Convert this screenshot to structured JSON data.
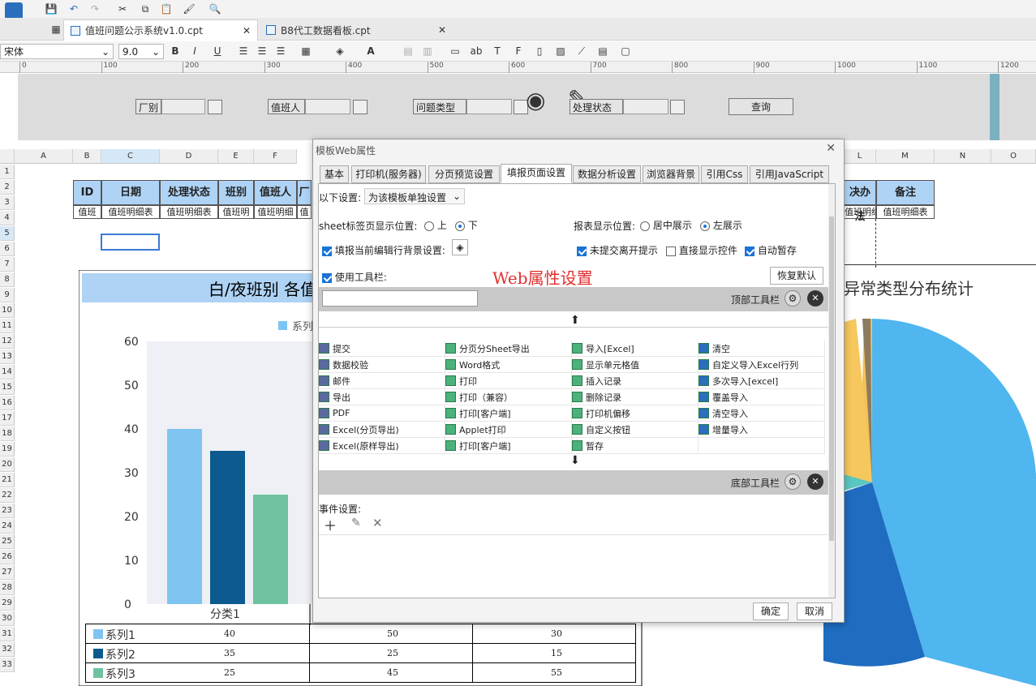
{
  "tabs": [
    {
      "label": "值班问题公示系统v1.0.cpt",
      "active": true
    },
    {
      "label": "B8代工数据看板.cpt",
      "active": false
    }
  ],
  "format": {
    "font": "宋体",
    "size": "9.0"
  },
  "ruler": [
    "0",
    "100",
    "200",
    "300",
    "400",
    "500",
    "600",
    "700",
    "800",
    "900",
    "1000",
    "1100",
    "1200"
  ],
  "params": {
    "factory": "厂别",
    "person": "值班人",
    "issue_type": "问题类型",
    "status": "处理状态",
    "query": "查询"
  },
  "columns": [
    "A",
    "B",
    "C",
    "D",
    "E",
    "F",
    "L",
    "M",
    "N",
    "O"
  ],
  "rows": [
    "1",
    "2",
    "3",
    "4",
    "5",
    "6",
    "7",
    "8",
    "9",
    "10",
    "11",
    "12",
    "13",
    "14",
    "15",
    "16",
    "17",
    "18",
    "19",
    "20",
    "21",
    "22",
    "23",
    "24",
    "25",
    "26",
    "27",
    "28",
    "29",
    "30",
    "31",
    "32",
    "33"
  ],
  "headers": [
    "ID",
    "日期",
    "处理状态",
    "班别",
    "值班人",
    "厂",
    "决办法",
    "备注"
  ],
  "datarow": [
    "值班",
    "值班明细表",
    "值班明细表",
    "值班明",
    "值班明细",
    "值",
    "值班明细表",
    "值班明细表"
  ],
  "chart_data": [
    {
      "type": "bar",
      "title": "白/夜班别 各值",
      "legend": "系列",
      "categories": [
        "分类1"
      ],
      "series": [
        {
          "name": "系列1",
          "values": [
            40
          ]
        },
        {
          "name": "系列2",
          "values": [
            35
          ]
        },
        {
          "name": "系列3",
          "values": [
            25
          ]
        }
      ],
      "ylim": [
        0,
        60
      ],
      "yticks": [
        "60",
        "50",
        "40",
        "30",
        "20",
        "10",
        "0"
      ],
      "colors": [
        "#7ec4f1",
        "#0c5a8f",
        "#6fc2a0"
      ]
    },
    {
      "type": "pie",
      "title": "异常类型分布统计"
    }
  ],
  "table_rows": [
    {
      "name": "系列1",
      "v": [
        "40",
        "50",
        "30"
      ],
      "color": "#7ec4f1"
    },
    {
      "name": "系列2",
      "v": [
        "35",
        "25",
        "15"
      ],
      "color": "#0c5a8f"
    },
    {
      "name": "系列3",
      "v": [
        "25",
        "45",
        "55"
      ],
      "color": "#6fc2a0"
    }
  ],
  "dialog": {
    "title": "模板Web属性",
    "tabs": [
      "基本",
      "打印机(服务器)",
      "分页预览设置",
      "填报页面设置",
      "数据分析设置",
      "浏览器背景",
      "引用Css",
      "引用JavaScript"
    ],
    "active_tab": 3,
    "setting_label": "以下设置:",
    "setting_value": "为该模板单独设置",
    "sheet_pos": "sheet标签页显示位置:",
    "up": "上",
    "down": "下",
    "report_pos": "报表显示位置:",
    "center": "居中展示",
    "left": "左展示",
    "row_bg": "填报当前编辑行背景设置:",
    "unsubmit": "未提交离开提示",
    "direct": "直接显示控件",
    "autosave": "自动暂存",
    "use_toolbar": "使用工具栏:",
    "overlay": "Web属性设置",
    "restore": "恢复默认",
    "top_toolbar": "顶部工具栏",
    "bottom_toolbar": "底部工具栏",
    "events": "事件设置:",
    "ok": "确定",
    "cancel": "取消",
    "items": [
      [
        "提交",
        "分页分Sheet导出",
        "导入[Excel]",
        "清空"
      ],
      [
        "数据校验",
        "Word格式",
        "显示单元格值",
        "自定义导入Excel行列"
      ],
      [
        "邮件",
        "打印",
        "插入记录",
        "多次导入[excel]"
      ],
      [
        "导出",
        "打印（兼容）",
        "删除记录",
        "覆盖导入"
      ],
      [
        "PDF",
        "打印[客户端]",
        "打印机偏移",
        "清空导入"
      ],
      [
        "Excel(分页导出)",
        "Applet打印",
        "自定义按钮",
        "增量导入"
      ],
      [
        "Excel(原样导出)",
        "打印[客户端]",
        "暂存",
        ""
      ]
    ]
  }
}
